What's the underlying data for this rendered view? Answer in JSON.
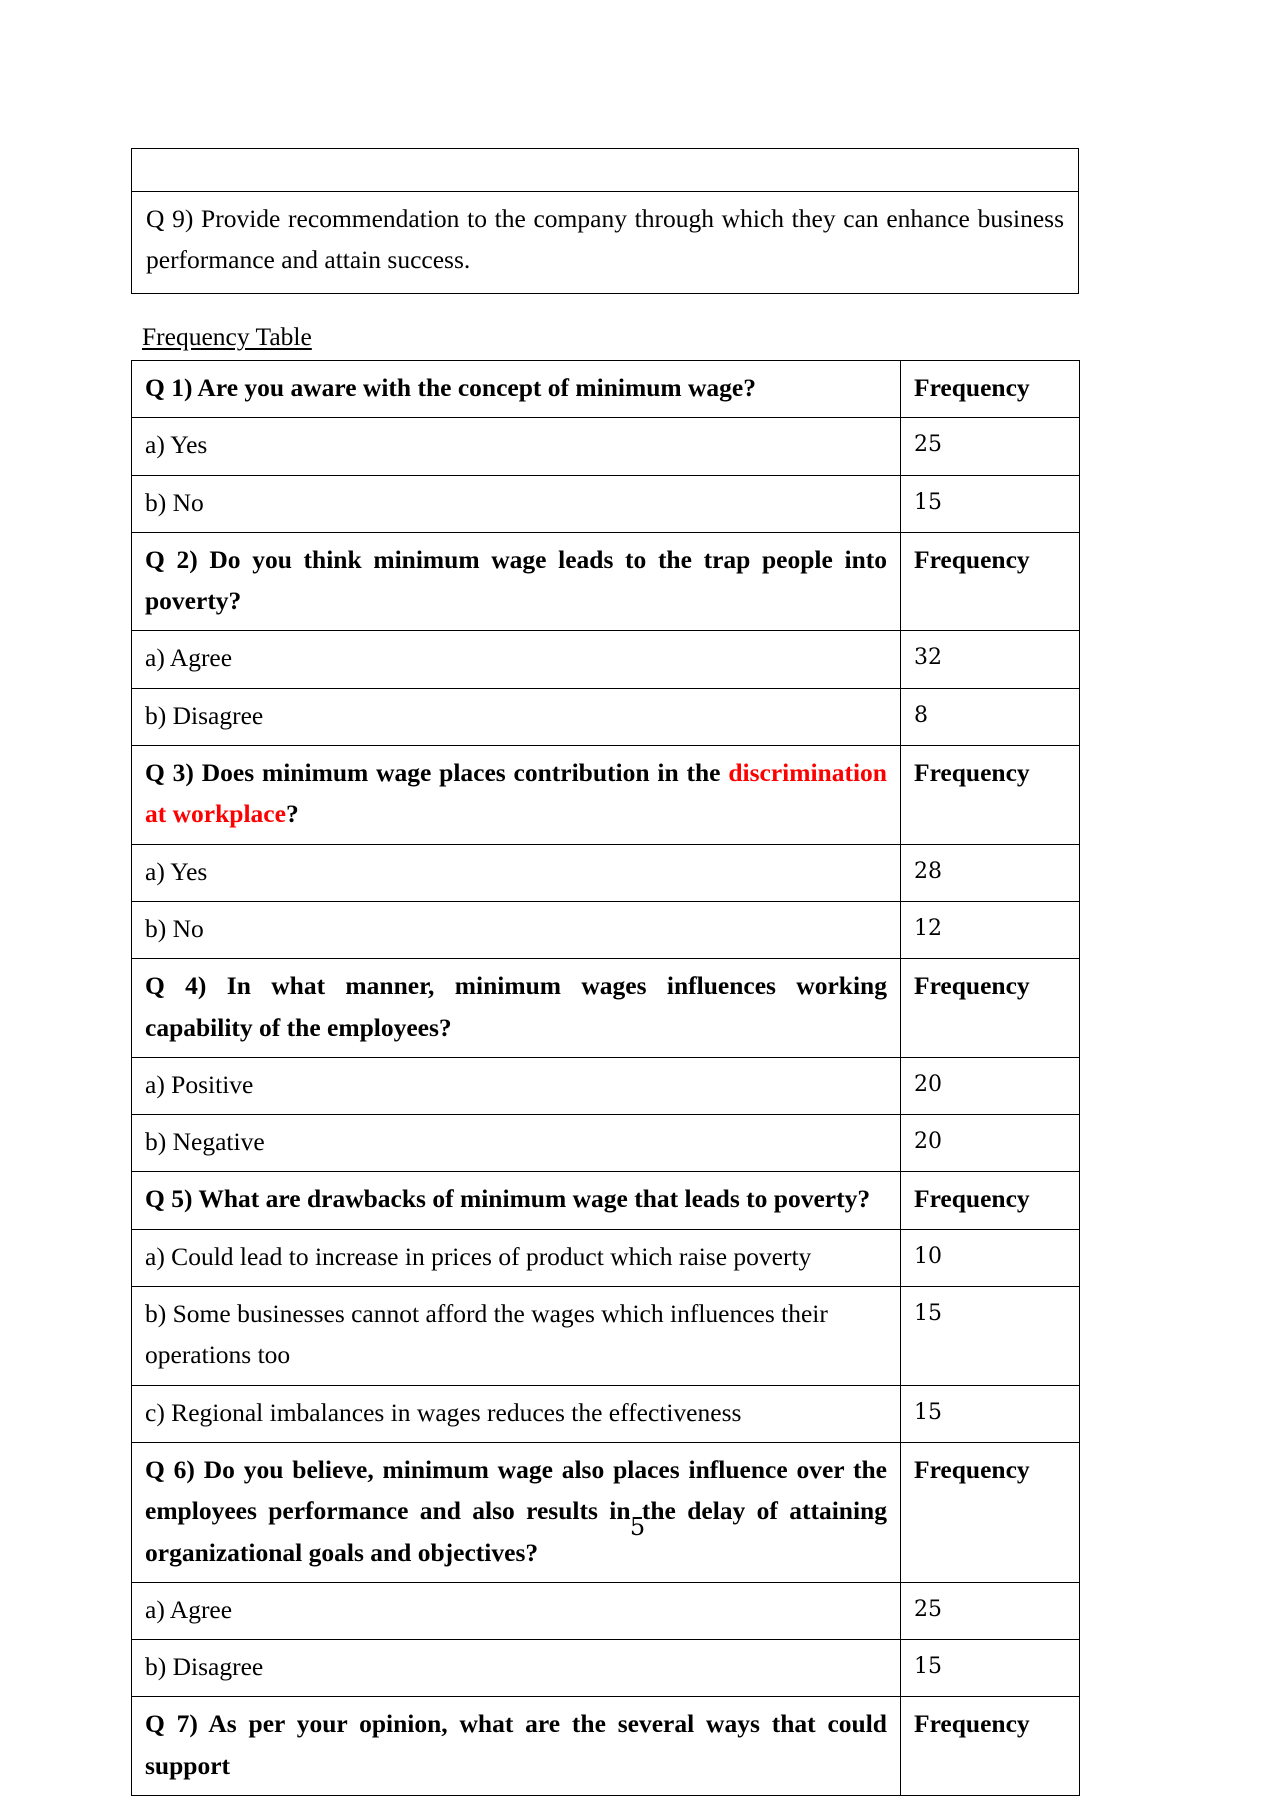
{
  "document": {
    "page_number": "5",
    "section_heading": "Frequency Table",
    "accent_red": "#ff0000"
  },
  "top_table": {
    "empty_row": "",
    "q9_text": "Q 9) Provide recommendation to the company through which they can enhance business performance and attain success."
  },
  "frequency_table": {
    "rows": [
      {
        "type": "question",
        "label": "Q 1) Are you aware with the concept of minimum wage?",
        "value": "Frequency"
      },
      {
        "type": "option",
        "label": "a) Yes",
        "value": "25"
      },
      {
        "type": "option",
        "label": "b) No",
        "value": "15"
      },
      {
        "type": "question",
        "label": "Q 2) Do you think minimum wage leads to the trap people into poverty?",
        "value": "Frequency"
      },
      {
        "type": "option",
        "label": "a) Agree",
        "value": "32"
      },
      {
        "type": "option",
        "label": "b) Disagree",
        "value": "8"
      },
      {
        "type": "question",
        "label": "Q 3) Does minimum wage places contribution in the discrimination at workplace?",
        "label_prefix": "Q 3) Does minimum wage places contribution in the ",
        "label_highlight": "discrimination at workplace",
        "label_suffix": "?",
        "value": "Frequency"
      },
      {
        "type": "option",
        "label": "a) Yes",
        "value": "28"
      },
      {
        "type": "option",
        "label": "b) No",
        "value": "12"
      },
      {
        "type": "question",
        "label": "Q 4) In what manner, minimum wages influences working capability of the employees?",
        "value": "Frequency"
      },
      {
        "type": "option",
        "label": "a) Positive",
        "value": "20"
      },
      {
        "type": "option",
        "label": "b) Negative",
        "value": "20"
      },
      {
        "type": "question",
        "label": "Q 5) What are drawbacks of minimum wage that leads to poverty?",
        "value": "Frequency"
      },
      {
        "type": "option",
        "label": "a) Could lead to increase in prices of product which raise poverty",
        "value": "10"
      },
      {
        "type": "option",
        "label": "b) Some businesses cannot afford the wages which influences their operations too",
        "value": "15"
      },
      {
        "type": "option",
        "label": "c) Regional imbalances in wages reduces the effectiveness",
        "value": "15"
      },
      {
        "type": "question",
        "label": "Q 6) Do you believe, minimum wage also places influence over the employees performance and also results in the delay of attaining organizational goals and objectives?",
        "value": "Frequency"
      },
      {
        "type": "option",
        "label": "a) Agree",
        "value": "25"
      },
      {
        "type": "option",
        "label": "b) Disagree",
        "value": "15"
      },
      {
        "type": "question",
        "label": "Q 7) As per your opinion, what are the several ways that could support",
        "value": "Frequency"
      }
    ]
  }
}
